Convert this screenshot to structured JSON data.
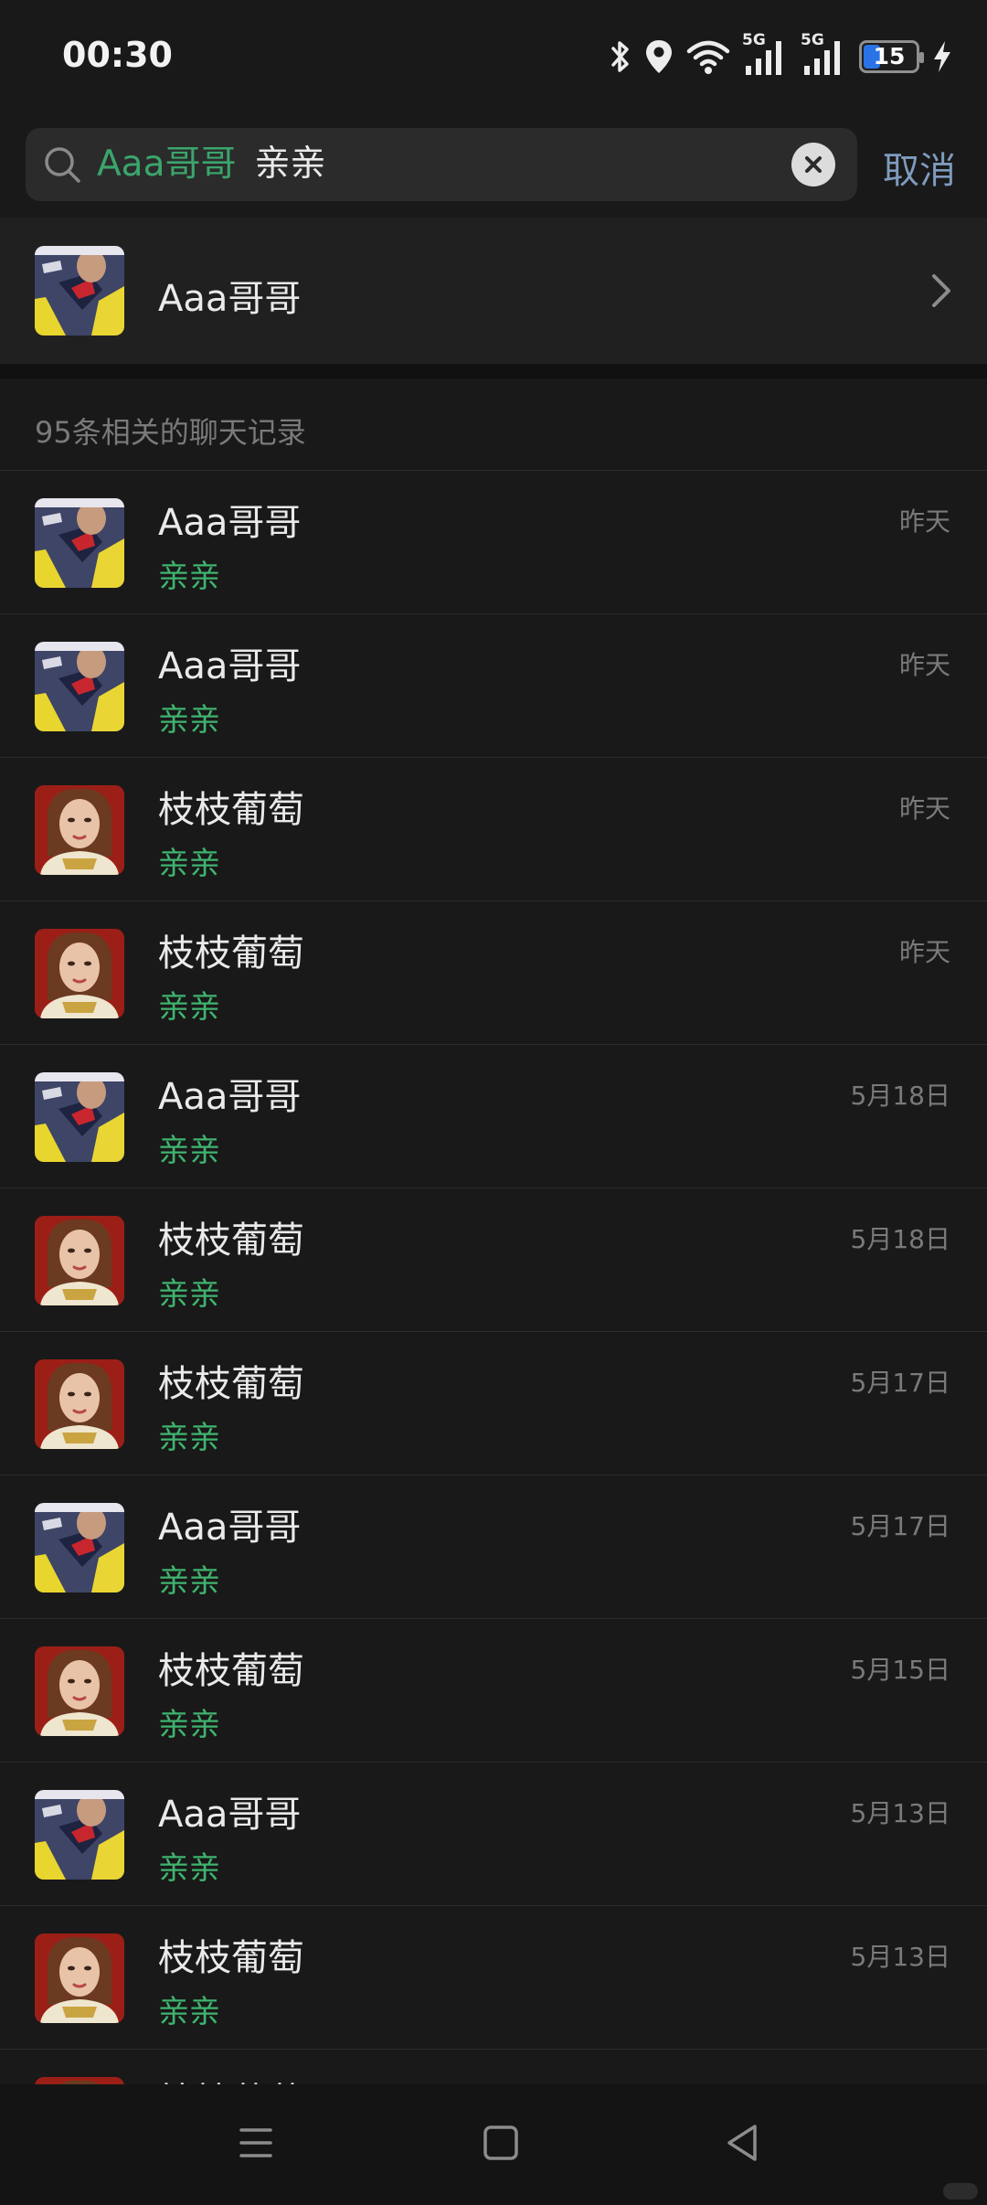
{
  "status_bar": {
    "time": "00:30",
    "battery": 15,
    "network_labels": [
      "5G",
      "5G"
    ],
    "icons": [
      "bluetooth-icon",
      "location-icon",
      "wifi-icon",
      "signal-icon",
      "signal-icon",
      "battery-icon",
      "charging-icon"
    ]
  },
  "search": {
    "keyword": "Aaa哥哥",
    "term": "亲亲",
    "cancel_label": "取消",
    "icons": [
      "search-icon",
      "clear-icon"
    ]
  },
  "contact": {
    "name": "Aaa哥哥",
    "avatar": "avatar-aaa"
  },
  "records_title": "95条相关的聊天记录",
  "records": [
    {
      "name": "Aaa哥哥",
      "message": "亲亲",
      "date": "昨天",
      "avatar": "avatar-aaa"
    },
    {
      "name": "Aaa哥哥",
      "message": "亲亲",
      "date": "昨天",
      "avatar": "avatar-aaa"
    },
    {
      "name": "枝枝葡萄",
      "message": "亲亲",
      "date": "昨天",
      "avatar": "avatar-zhizhi"
    },
    {
      "name": "枝枝葡萄",
      "message": "亲亲",
      "date": "昨天",
      "avatar": "avatar-zhizhi"
    },
    {
      "name": "Aaa哥哥",
      "message": "亲亲",
      "date": "5月18日",
      "avatar": "avatar-aaa"
    },
    {
      "name": "枝枝葡萄",
      "message": "亲亲",
      "date": "5月18日",
      "avatar": "avatar-zhizhi"
    },
    {
      "name": "枝枝葡萄",
      "message": "亲亲",
      "date": "5月17日",
      "avatar": "avatar-zhizhi"
    },
    {
      "name": "Aaa哥哥",
      "message": "亲亲",
      "date": "5月17日",
      "avatar": "avatar-aaa"
    },
    {
      "name": "枝枝葡萄",
      "message": "亲亲",
      "date": "5月15日",
      "avatar": "avatar-zhizhi"
    },
    {
      "name": "Aaa哥哥",
      "message": "亲亲",
      "date": "5月13日",
      "avatar": "avatar-aaa"
    },
    {
      "name": "枝枝葡萄",
      "message": "亲亲",
      "date": "5月13日",
      "avatar": "avatar-zhizhi"
    },
    {
      "name": "枝枝葡萄",
      "message": "",
      "date": "",
      "avatar": "avatar-zhizhi"
    }
  ],
  "navbar": {
    "buttons": [
      "menu-icon",
      "home-icon",
      "back-icon"
    ]
  },
  "colors": {
    "background": "#191919",
    "highlight_green": "#3fb46e",
    "cancel_blue": "#7f9bbe",
    "battery_blue": "#2a73e6"
  }
}
